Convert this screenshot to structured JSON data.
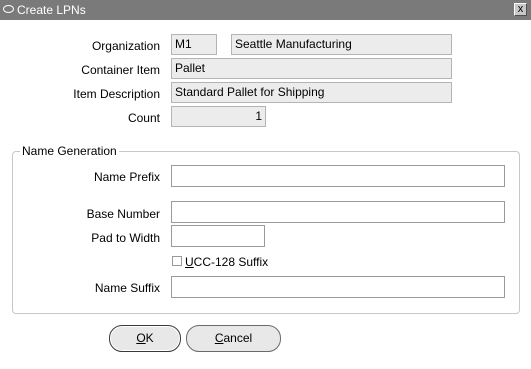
{
  "window": {
    "title": "Create LPNs",
    "close_glyph": "x"
  },
  "header": {
    "organization_label": "Organization",
    "organization_code": "M1",
    "organization_name": "Seattle Manufacturing",
    "container_item_label": "Container Item",
    "container_item_value": "Pallet",
    "item_description_label": "Item Description",
    "item_description_value": "Standard Pallet for Shipping",
    "count_label": "Count",
    "count_value": "1"
  },
  "name_generation": {
    "legend": "Name Generation",
    "name_prefix_label": "Name Prefix",
    "name_prefix_value": "",
    "base_number_label": "Base Number",
    "base_number_value": "",
    "pad_to_width_label": "Pad to Width",
    "pad_to_width_value": "",
    "ucc_checkbox_first": "U",
    "ucc_checkbox_rest": "CC-128 Suffix",
    "ucc_checked": false,
    "name_suffix_label": "Name Suffix",
    "name_suffix_value": ""
  },
  "buttons": {
    "ok_mnemonic": "O",
    "ok_rest": "K",
    "cancel_mnemonic": "C",
    "cancel_rest": "ancel"
  },
  "colors": {
    "titlebar": "#7a7a7a",
    "readonly_bg": "#ececec"
  }
}
